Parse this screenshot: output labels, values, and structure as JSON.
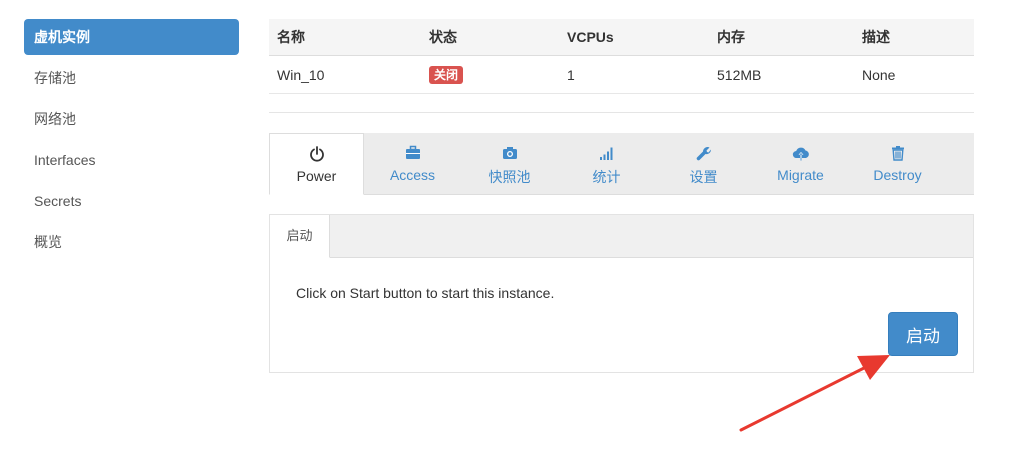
{
  "sidebar": {
    "items": [
      {
        "label": "虚机实例",
        "active": true
      },
      {
        "label": "存储池"
      },
      {
        "label": "网络池"
      },
      {
        "label": "Interfaces"
      },
      {
        "label": "Secrets"
      },
      {
        "label": "概览"
      }
    ]
  },
  "instance_table": {
    "headers": [
      "名称",
      "状态",
      "VCPUs",
      "内存",
      "描述"
    ],
    "row": {
      "name": "Win_10",
      "status": "关闭",
      "vcpus": "1",
      "memory": "512MB",
      "description": "None"
    }
  },
  "tabs": [
    {
      "label": "Power",
      "icon": "power-icon",
      "active": true
    },
    {
      "label": "Access",
      "icon": "briefcase-icon"
    },
    {
      "label": "快照池",
      "icon": "camera-icon"
    },
    {
      "label": "统计",
      "icon": "signal-bars-icon"
    },
    {
      "label": "设置",
      "icon": "wrench-icon"
    },
    {
      "label": "Migrate",
      "icon": "cloud-upload-icon"
    },
    {
      "label": "Destroy",
      "icon": "trash-icon"
    }
  ],
  "power_panel": {
    "subtab": "启动",
    "message": "Click on Start button to start this instance.",
    "start_button": "启动"
  },
  "colors": {
    "primary": "#428bca",
    "danger": "#d9534f",
    "annotation_arrow": "#e8392f"
  }
}
